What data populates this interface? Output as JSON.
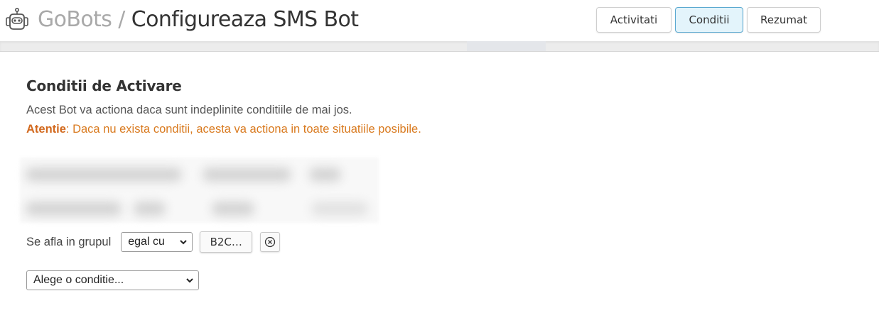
{
  "header": {
    "brand": "GoBots",
    "separator": " / ",
    "page_title": "Configureaza SMS Bot",
    "tabs": [
      {
        "label": "Activitati",
        "active": false
      },
      {
        "label": "Conditii",
        "active": true
      },
      {
        "label": "Rezumat",
        "active": false
      }
    ],
    "logo_icon": "robot-icon"
  },
  "section": {
    "heading": "Conditii de Activare",
    "description": "Acest Bot va actiona daca sunt indeplinite conditiile de mai jos.",
    "warning_label": "Atentie",
    "warning_text": ": Daca nu exista conditii, acesta va actiona in toate situatiile posibile."
  },
  "condition": {
    "label": "Se afla in grupul",
    "operator": "egal cu",
    "value": "B2C…",
    "remove_icon": "close-circle-icon"
  },
  "new_condition": {
    "placeholder": "Alege o conditie..."
  },
  "colors": {
    "warning": "#d97a1f",
    "active_tab_bg": "#e3f4fb",
    "active_tab_border": "#5aa8d0"
  }
}
